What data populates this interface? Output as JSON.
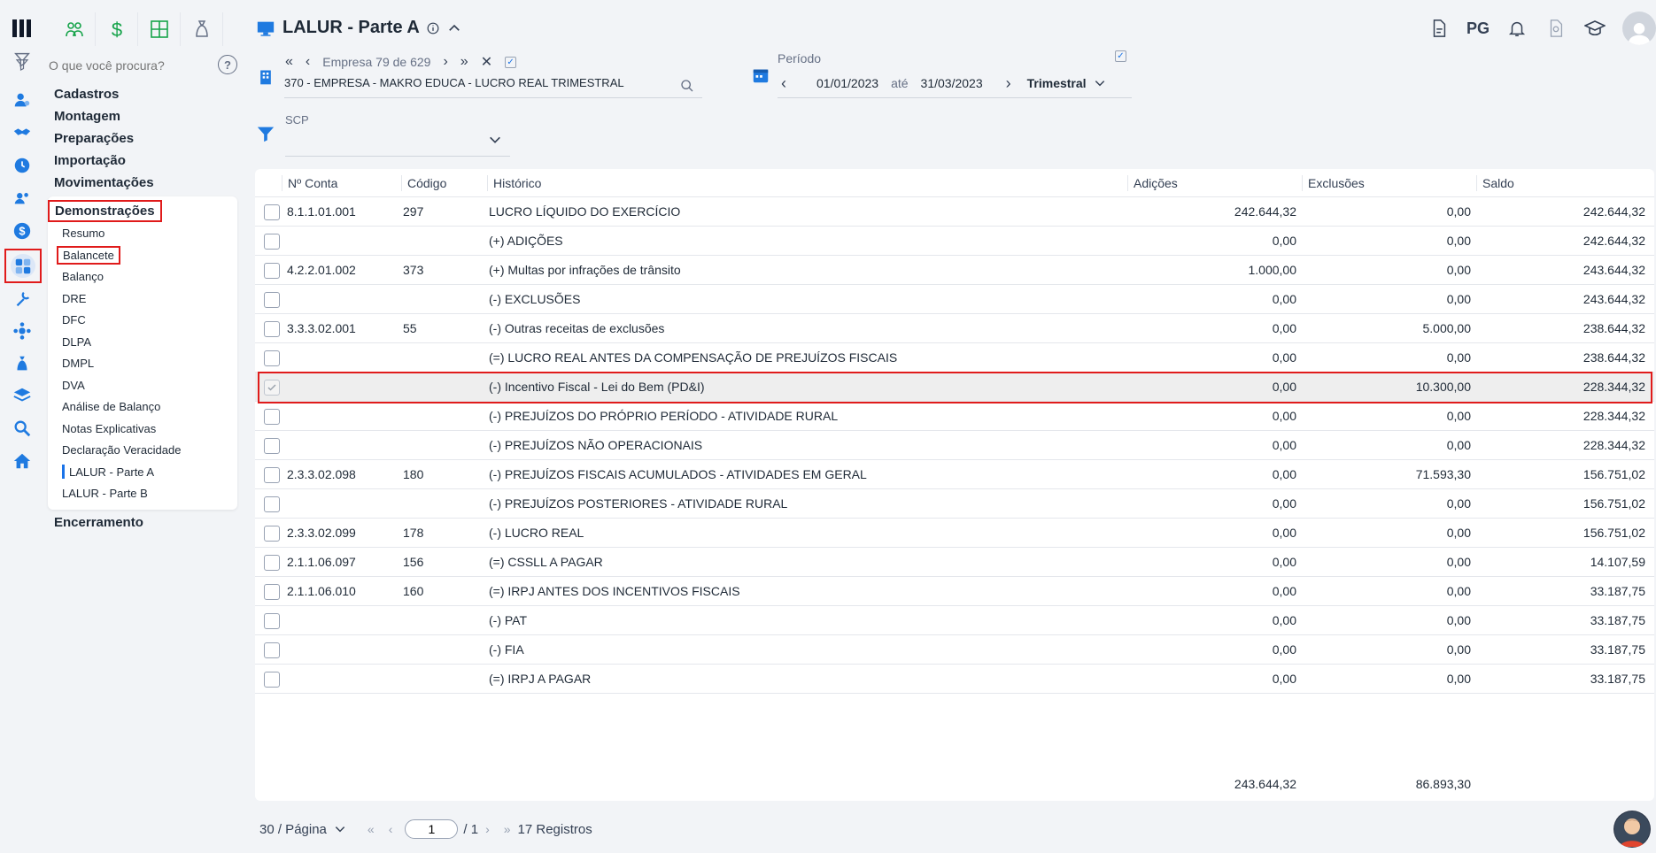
{
  "search": {
    "placeholder": "O que você procura?",
    "help": "?"
  },
  "menu": {
    "items": [
      "Cadastros",
      "Montagem",
      "Preparações",
      "Importação",
      "Movimentações"
    ],
    "demonstracoes": {
      "title": "Demonstrações",
      "items": [
        "Resumo",
        "Balancete",
        "Balanço",
        "DRE",
        "DFC",
        "DLPA",
        "DMPL",
        "DVA",
        "Análise de Balanço",
        "Notas Explicativas",
        "Declaração Veracidade",
        "LALUR - Parte A",
        "LALUR - Parte B"
      ]
    },
    "encerramento": "Encerramento"
  },
  "header": {
    "title": "LALUR - Parte A",
    "user_initials": "PG"
  },
  "empresa": {
    "label": "Empresa",
    "position": "79 de 629",
    "name": "370 - EMPRESA - MAKRO EDUCA - LUCRO REAL TRIMESTRAL"
  },
  "periodo": {
    "label": "Período",
    "start": "01/01/2023",
    "sep": "até",
    "end": "31/03/2023",
    "type": "Trimestral"
  },
  "scp": {
    "label": "SCP"
  },
  "table": {
    "columns": [
      "Nº Conta",
      "Código",
      "Histórico",
      "Adições",
      "Exclusões",
      "Saldo"
    ],
    "rows": [
      {
        "conta": "8.1.1.01.001",
        "codigo": "297",
        "historico": "LUCRO LÍQUIDO DO EXERCÍCIO",
        "adicoes": "242.644,32",
        "exclusoes": "0,00",
        "saldo": "242.644,32"
      },
      {
        "conta": "",
        "codigo": "",
        "historico": "(+) ADIÇÕES",
        "adicoes": "0,00",
        "exclusoes": "0,00",
        "saldo": "242.644,32"
      },
      {
        "conta": "4.2.2.01.002",
        "codigo": "373",
        "historico": "(+) Multas por infrações de trânsito",
        "adicoes": "1.000,00",
        "exclusoes": "0,00",
        "saldo": "243.644,32"
      },
      {
        "conta": "",
        "codigo": "",
        "historico": "(-) EXCLUSÕES",
        "adicoes": "0,00",
        "exclusoes": "0,00",
        "saldo": "243.644,32"
      },
      {
        "conta": "3.3.3.02.001",
        "codigo": "55",
        "historico": "(-) Outras receitas de exclusões",
        "adicoes": "0,00",
        "exclusoes": "5.000,00",
        "saldo": "238.644,32"
      },
      {
        "conta": "",
        "codigo": "",
        "historico": "(=) LUCRO REAL ANTES DA COMPENSAÇÃO DE PREJUÍZOS FISCAIS",
        "adicoes": "0,00",
        "exclusoes": "0,00",
        "saldo": "238.644,32"
      },
      {
        "conta": "",
        "codigo": "",
        "historico": "(-) Incentivo Fiscal - Lei do Bem (PD&I)",
        "adicoes": "0,00",
        "exclusoes": "10.300,00",
        "saldo": "228.344,32",
        "highlight": true
      },
      {
        "conta": "",
        "codigo": "",
        "historico": "(-) PREJUÍZOS DO PRÓPRIO PERÍODO - ATIVIDADE RURAL",
        "adicoes": "0,00",
        "exclusoes": "0,00",
        "saldo": "228.344,32"
      },
      {
        "conta": "",
        "codigo": "",
        "historico": "(-) PREJUÍZOS NÃO OPERACIONAIS",
        "adicoes": "0,00",
        "exclusoes": "0,00",
        "saldo": "228.344,32"
      },
      {
        "conta": "2.3.3.02.098",
        "codigo": "180",
        "historico": "(-) PREJUÍZOS FISCAIS ACUMULADOS - ATIVIDADES EM GERAL",
        "adicoes": "0,00",
        "exclusoes": "71.593,30",
        "saldo": "156.751,02"
      },
      {
        "conta": "",
        "codigo": "",
        "historico": "(-) PREJUÍZOS POSTERIORES - ATIVIDADE RURAL",
        "adicoes": "0,00",
        "exclusoes": "0,00",
        "saldo": "156.751,02"
      },
      {
        "conta": "2.3.3.02.099",
        "codigo": "178",
        "historico": "(-) LUCRO REAL",
        "adicoes": "0,00",
        "exclusoes": "0,00",
        "saldo": "156.751,02"
      },
      {
        "conta": "2.1.1.06.097",
        "codigo": "156",
        "historico": "(=) CSSLL A PAGAR",
        "adicoes": "0,00",
        "exclusoes": "0,00",
        "saldo": "14.107,59"
      },
      {
        "conta": "2.1.1.06.010",
        "codigo": "160",
        "historico": "(=) IRPJ ANTES DOS INCENTIVOS FISCAIS",
        "adicoes": "0,00",
        "exclusoes": "0,00",
        "saldo": "33.187,75"
      },
      {
        "conta": "",
        "codigo": "",
        "historico": "(-) PAT",
        "adicoes": "0,00",
        "exclusoes": "0,00",
        "saldo": "33.187,75"
      },
      {
        "conta": "",
        "codigo": "",
        "historico": "(-) FIA",
        "adicoes": "0,00",
        "exclusoes": "0,00",
        "saldo": "33.187,75"
      },
      {
        "conta": "",
        "codigo": "",
        "historico": "(=) IRPJ A PAGAR",
        "adicoes": "0,00",
        "exclusoes": "0,00",
        "saldo": "33.187,75"
      }
    ],
    "totals": {
      "adicoes": "243.644,32",
      "exclusoes": "86.893,30"
    }
  },
  "pagination": {
    "per_page": "30 / Página",
    "current_page": "1",
    "total_pages": "/ 1",
    "records": "17 Registros"
  },
  "colors": {
    "accent": "#1a73e8",
    "highlight_border": "#e01b1b",
    "icon_blue": "#1f7ae0",
    "icon_green": "#16a34a"
  }
}
